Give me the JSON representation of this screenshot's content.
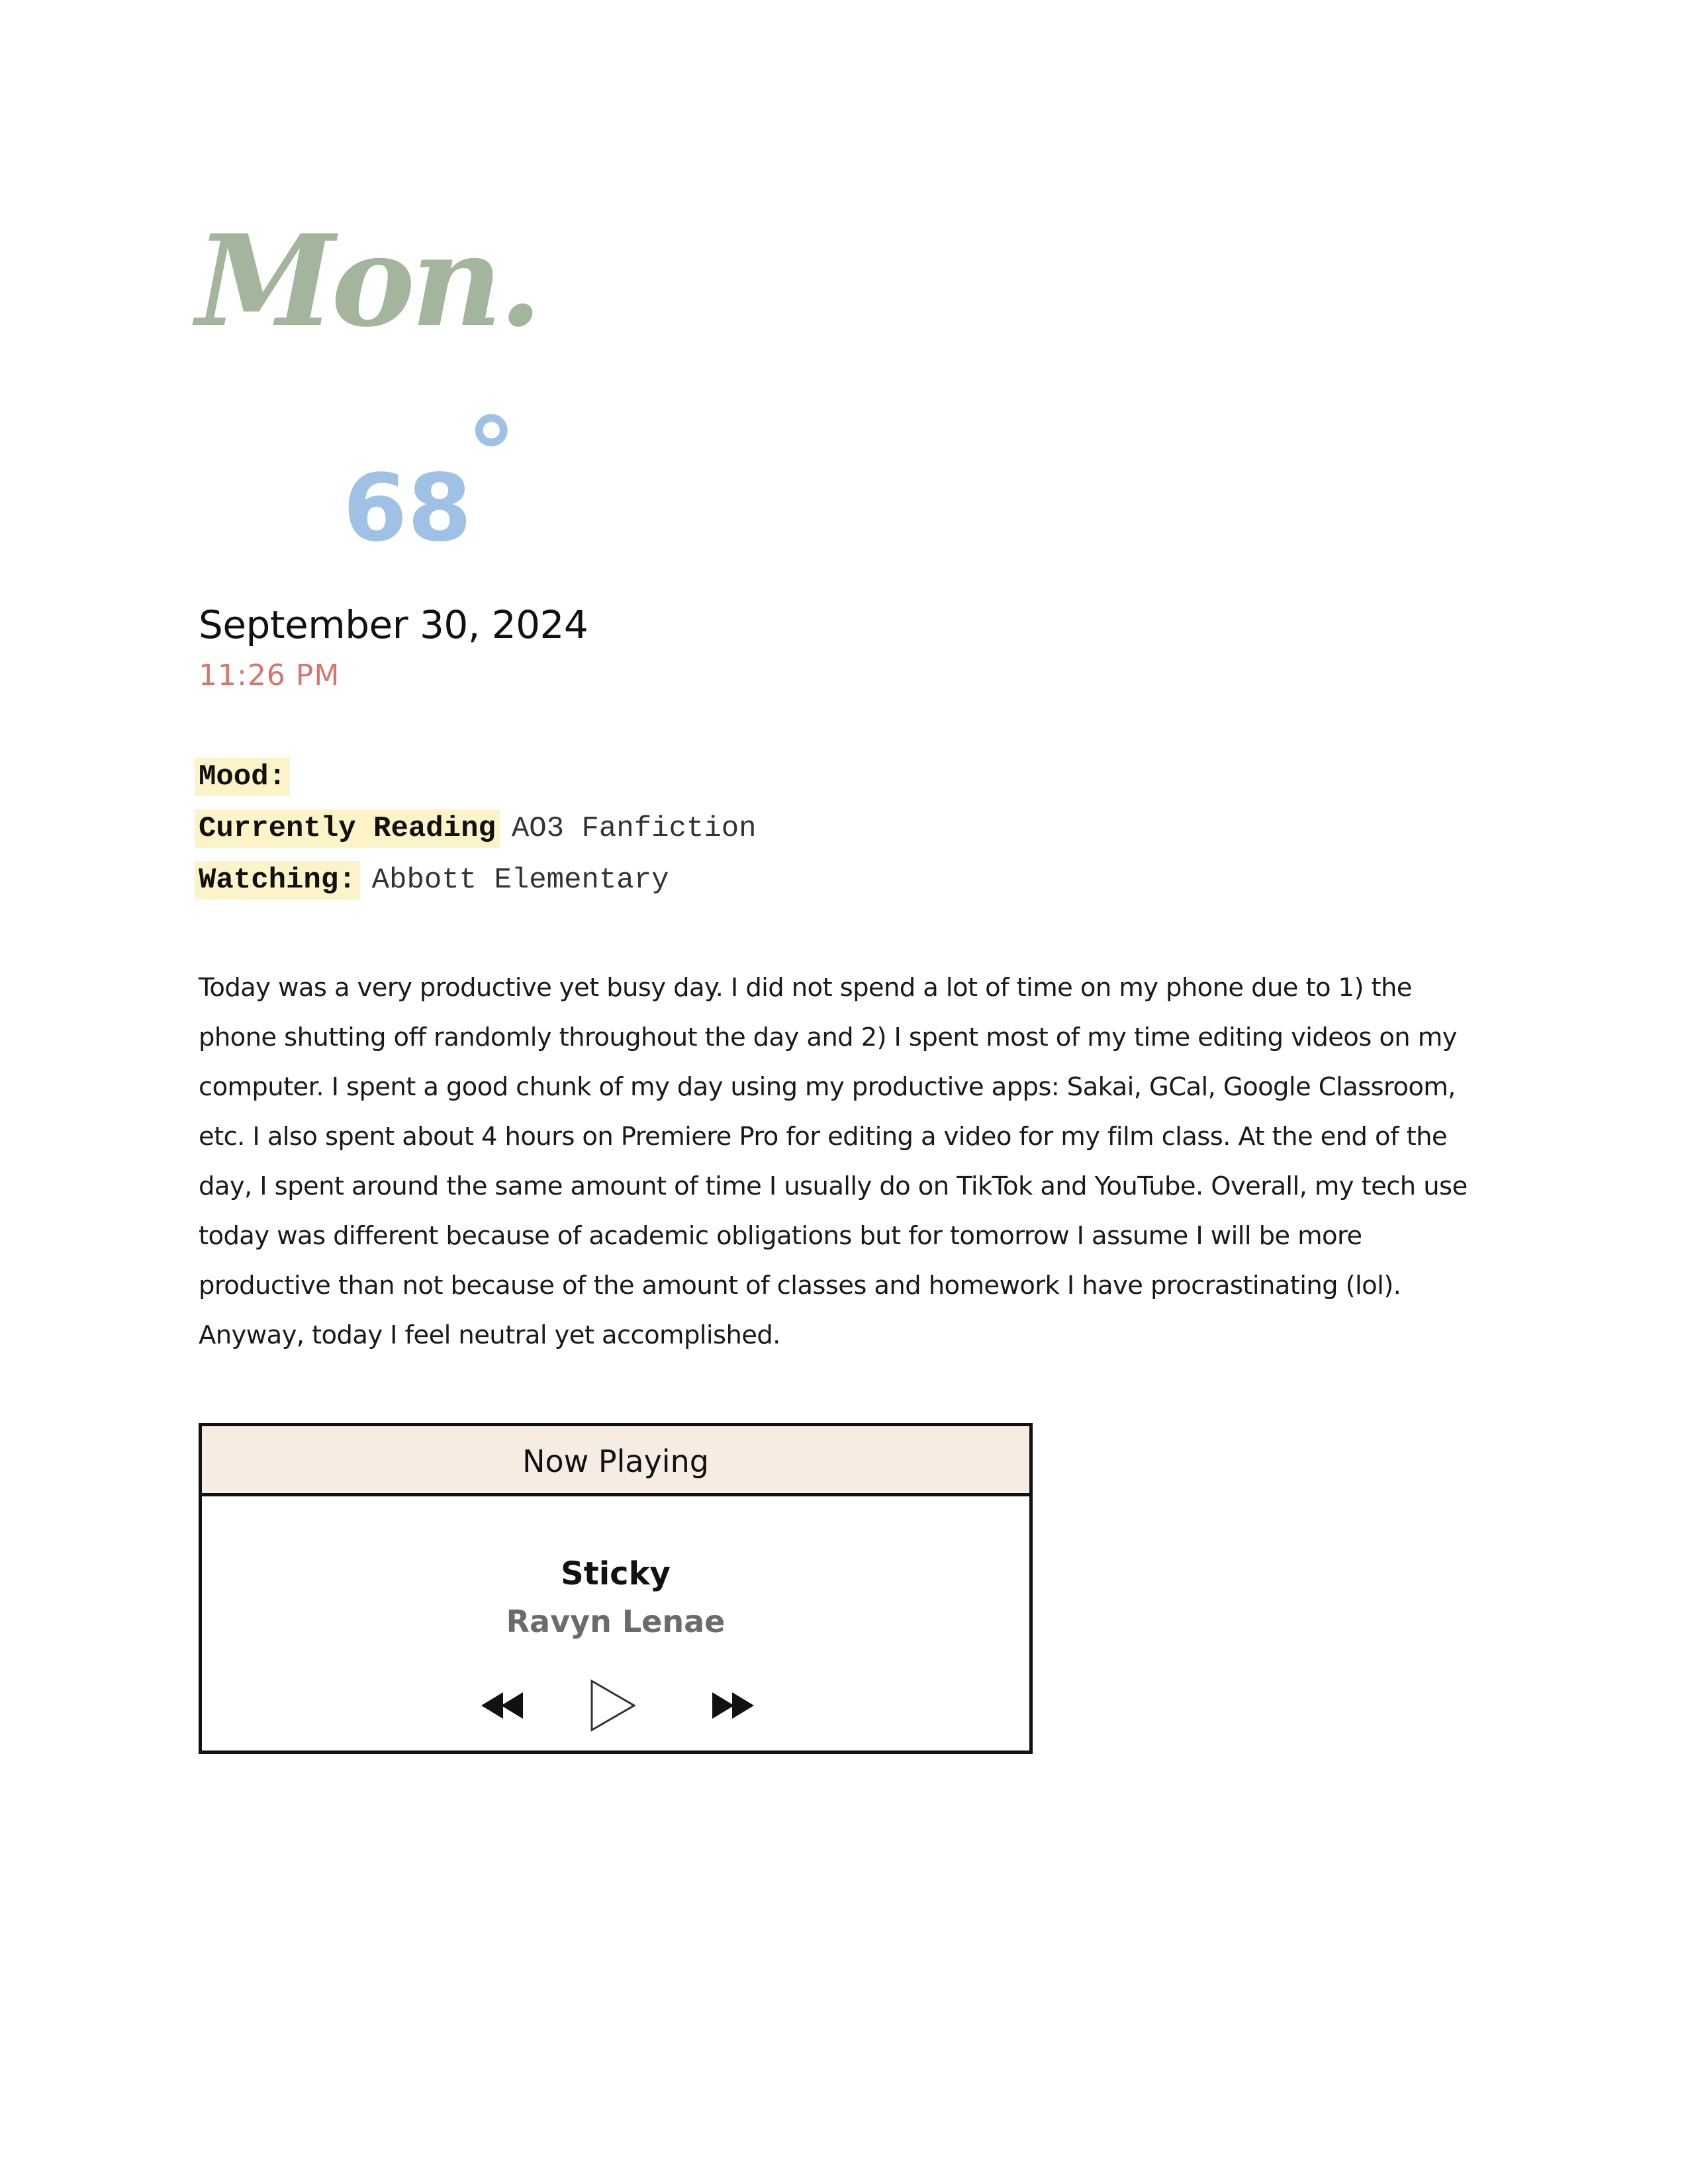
{
  "header": {
    "day": "Mon.",
    "temperature": "68",
    "degree_symbol": "°",
    "date": "September 30, 2024",
    "time": "11:26 PM"
  },
  "meta": {
    "mood_label": "Mood:",
    "mood_value": "",
    "reading_label": "Currently Reading",
    "reading_value": "AO3 Fanfiction",
    "watching_label": "Watching:",
    "watching_value": "Abbott Elementary"
  },
  "entry": {
    "body": "Today was a very productive yet busy day. I did not spend a lot of time on my phone due to 1) the phone shutting off randomly throughout the day and 2) I spent most of my time editing videos on my computer. I spent a good chunk of my day using my productive apps: Sakai, GCal, Google Classroom, etc. I also spent about 4 hours on Premiere Pro for editing a video for my film class. At the end of the day, I spent around the same amount of time I usually do on TikTok and YouTube. Overall, my tech use today was different because of academic obligations but for tomorrow I assume I will be more productive than not because of the amount of classes and homework I have procrastinating (lol). Anyway, today  I feel neutral yet accomplished."
  },
  "player": {
    "header": "Now Playing",
    "song": "Sticky",
    "artist": "Ravyn Lenae",
    "icons": {
      "rewind": "rewind-icon",
      "play": "play-icon",
      "fast_forward": "fast-forward-icon"
    }
  },
  "colors": {
    "day": "#a4b59d",
    "temperature": "#9fc1e6",
    "time": "#d9746c",
    "label_highlight": "#fdf3c8",
    "player_header_bg": "#f6ece2"
  }
}
